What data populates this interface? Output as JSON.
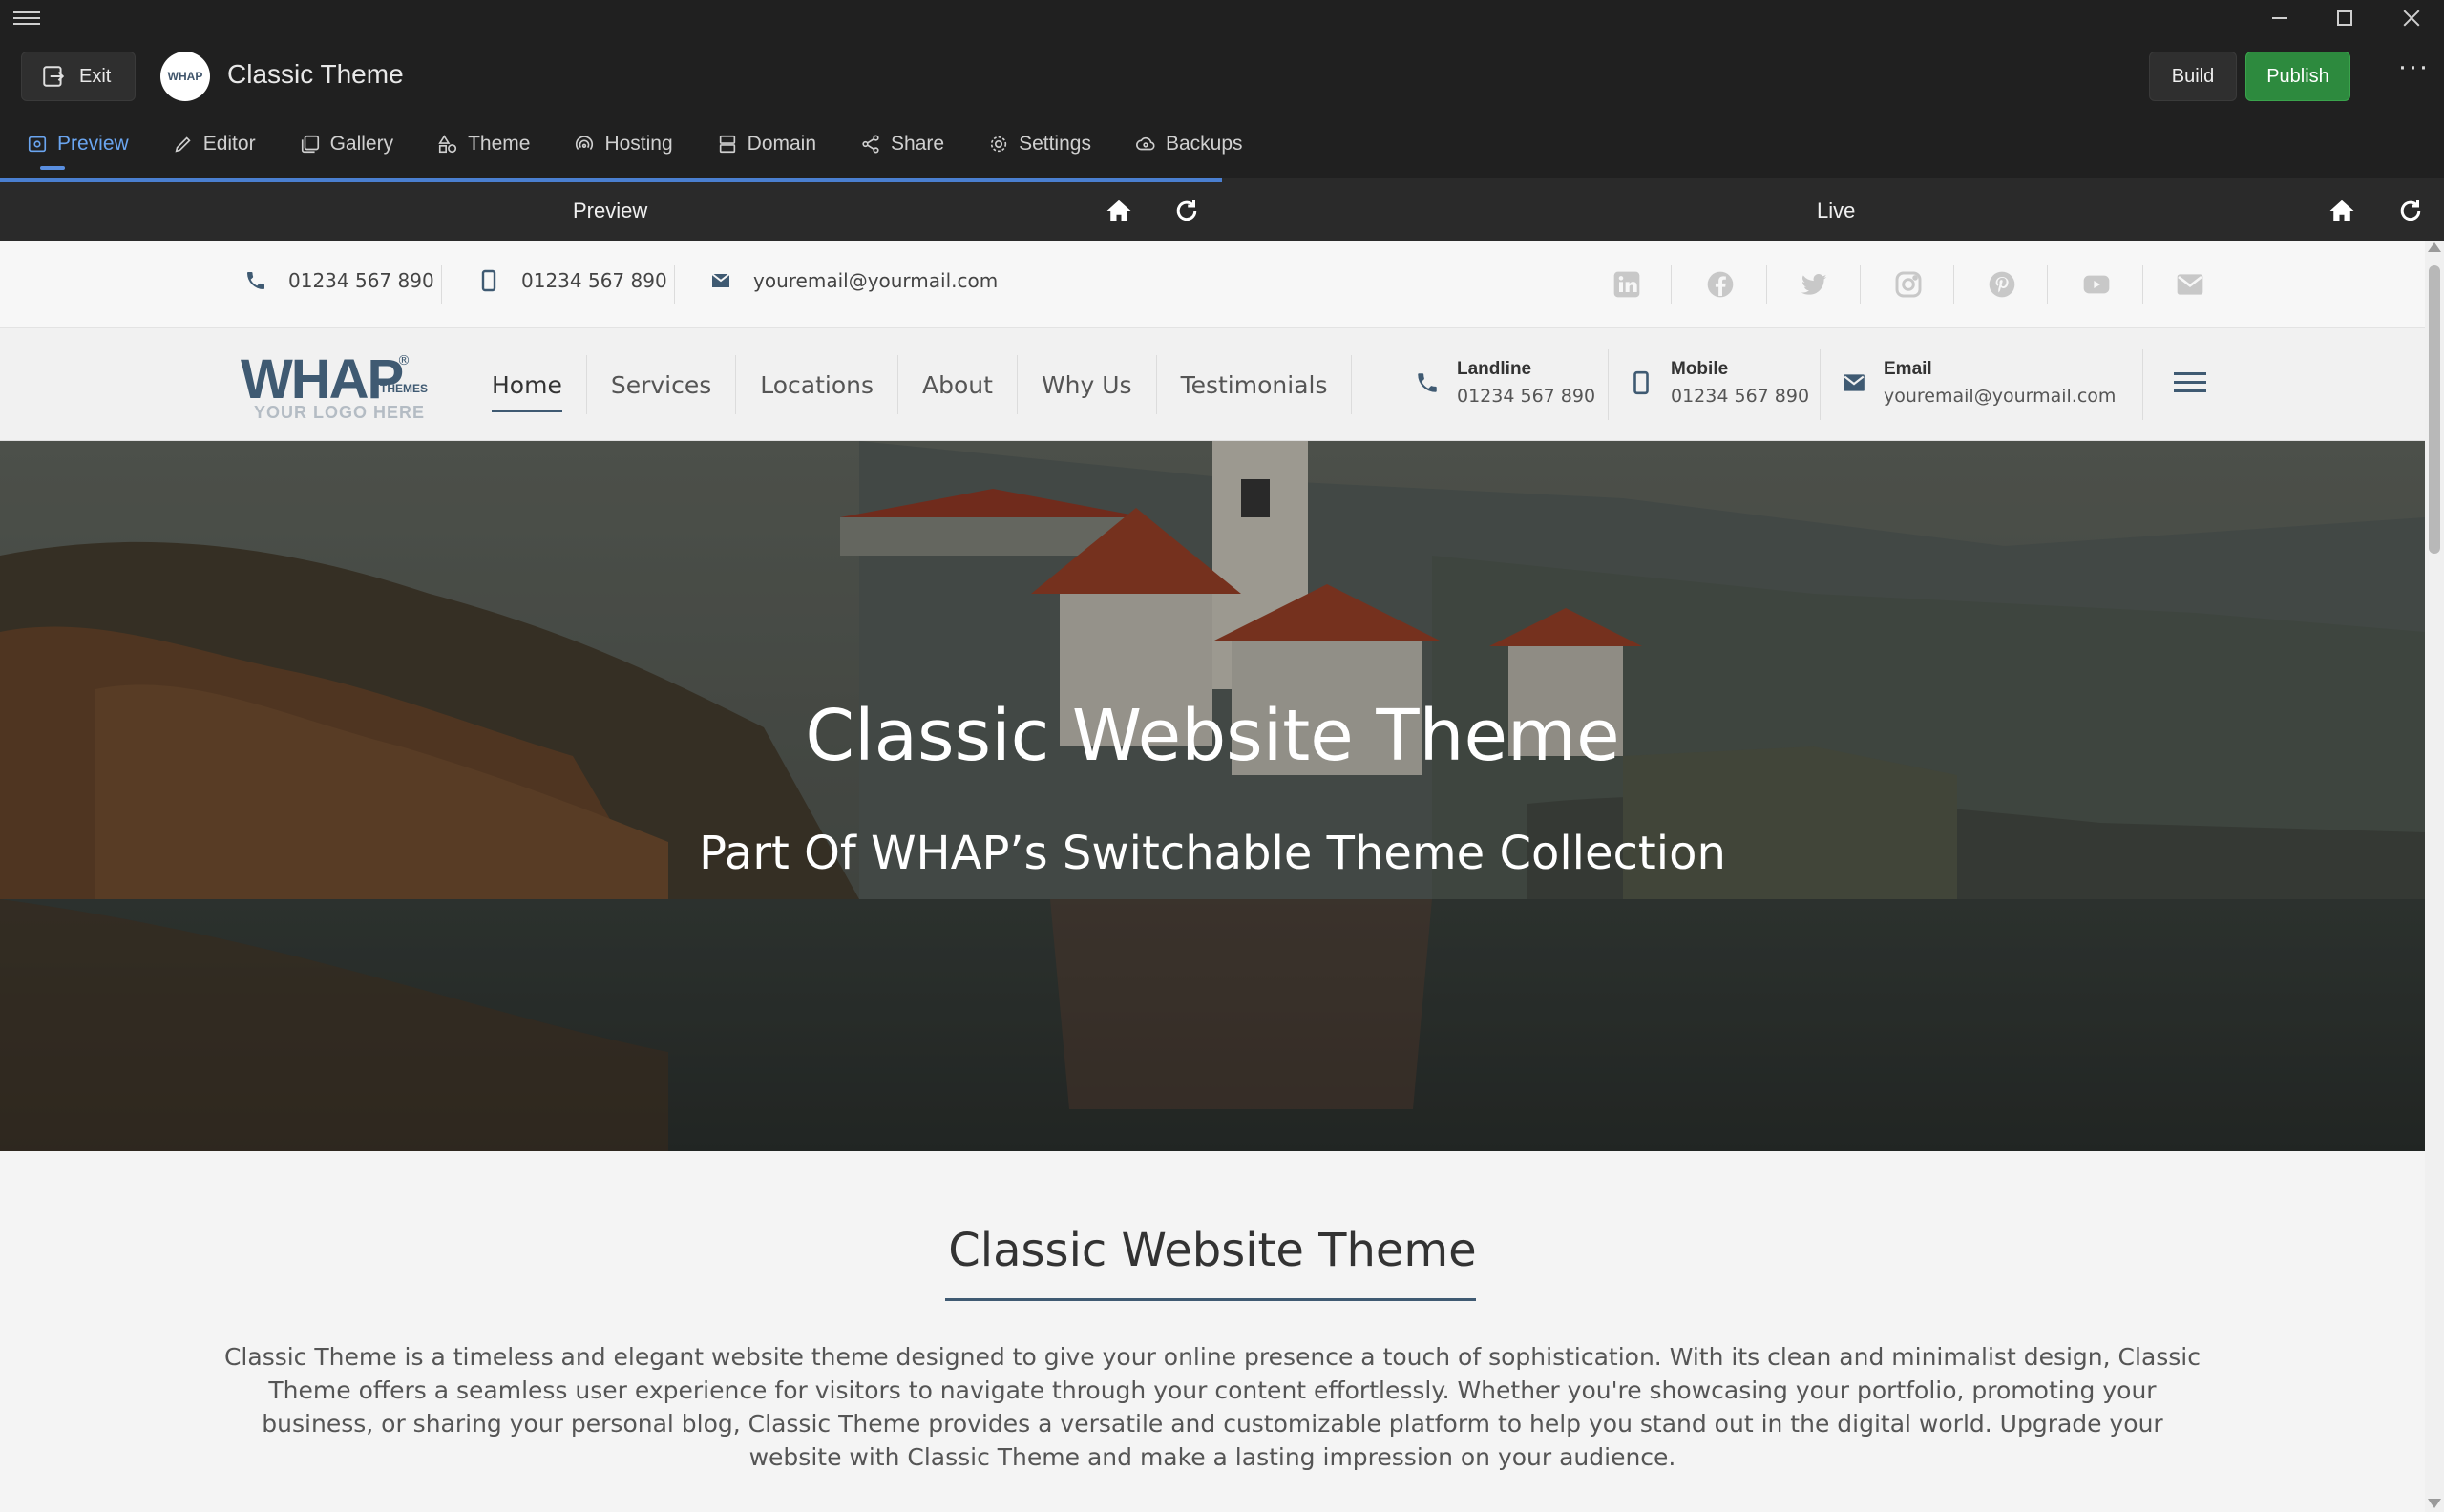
{
  "app": {
    "title": "Classic Theme",
    "exit_label": "Exit",
    "logo_text": "WHAP",
    "build_label": "Build",
    "publish_label": "Publish",
    "more_label": "···"
  },
  "tabs": [
    {
      "label": "Preview",
      "icon": "preview-icon",
      "active": true
    },
    {
      "label": "Editor",
      "icon": "pencil-icon"
    },
    {
      "label": "Gallery",
      "icon": "gallery-icon"
    },
    {
      "label": "Theme",
      "icon": "shapes-icon"
    },
    {
      "label": "Hosting",
      "icon": "hosting-icon"
    },
    {
      "label": "Domain",
      "icon": "server-icon"
    },
    {
      "label": "Share",
      "icon": "share-icon"
    },
    {
      "label": "Settings",
      "icon": "gear-icon"
    },
    {
      "label": "Backups",
      "icon": "cloud-backup-icon"
    }
  ],
  "panes": {
    "preview_label": "Preview",
    "live_label": "Live"
  },
  "site": {
    "topbar": {
      "landline": "01234 567 890",
      "mobile": "01234 567 890",
      "email": "youremail@yourmail.com",
      "socials": [
        "linkedin-icon",
        "facebook-icon",
        "twitter-icon",
        "instagram-icon",
        "pinterest-icon",
        "youtube-icon",
        "mail-icon"
      ]
    },
    "logo": {
      "main": "WHAP",
      "themes": "THEMES",
      "reg": "®",
      "sub": "YOUR LOGO HERE"
    },
    "menu": [
      "Home",
      "Services",
      "Locations",
      "About",
      "Why Us",
      "Testimonials"
    ],
    "contact": {
      "landline_label": "Landline",
      "landline_value": "01234 567 890",
      "mobile_label": "Mobile",
      "mobile_value": "01234 567 890",
      "email_label": "Email",
      "email_value": "youremail@yourmail.com"
    },
    "hero": {
      "title": "Classic Website Theme",
      "subtitle": "Part Of WHAP’s Switchable Theme Collection"
    },
    "section": {
      "title": "Classic Website Theme",
      "body": "Classic Theme is a timeless and elegant website theme designed to give your online presence a touch of sophistication. With its clean and minimalist design, Classic Theme offers a seamless user experience for visitors to navigate through your content effortlessly. Whether you're showcasing your portfolio, promoting your business, or sharing your personal blog, Classic Theme provides a versatile and customizable platform to help you stand out in the digital world. Upgrade your website with Classic Theme and make a lasting impression on your audience."
    }
  },
  "colors": {
    "accent": "#5a8fe0",
    "publish": "#2d8a3e",
    "brand": "#3f5a72"
  }
}
